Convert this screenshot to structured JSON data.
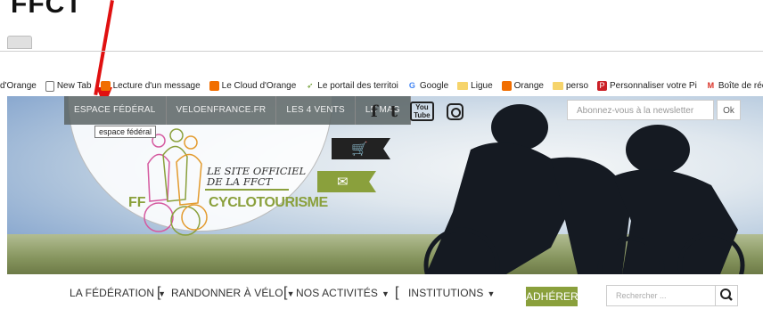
{
  "annotation": {
    "caption": "FFCT",
    "arrow_color": "#e01010"
  },
  "bookmarks": [
    {
      "label": "d'Orange",
      "icon": "none"
    },
    {
      "label": "New Tab",
      "icon": "page-icon"
    },
    {
      "label": "Lecture d'un message",
      "icon": "orange-icon"
    },
    {
      "label": "Le Cloud d'Orange",
      "icon": "orange-icon"
    },
    {
      "label": "Le portail des territoi",
      "icon": "portal-icon"
    },
    {
      "label": "Google",
      "icon": "google-icon"
    },
    {
      "label": "Ligue",
      "icon": "folder-icon"
    },
    {
      "label": "Orange",
      "icon": "orange-icon"
    },
    {
      "label": "perso",
      "icon": "folder-icon"
    },
    {
      "label": "Personnaliser votre Pi",
      "icon": "pinterest-icon"
    },
    {
      "label": "Boîte de réception",
      "icon": "gmail-icon"
    }
  ],
  "topnav": [
    "ESPACE FÉDÉRAL",
    "VELOENFRANCE.FR",
    "LES 4 VENTS",
    "LE MAG"
  ],
  "tooltip": "espace fédéral",
  "social": {
    "facebook": "f",
    "twitter": "t",
    "youtube_top": "You",
    "youtube_bottom": "Tube"
  },
  "newsletter": {
    "placeholder": "Abonnez-vous à la newsletter",
    "button": "Ok"
  },
  "logo": {
    "line1": "LE SITE OFFICIEL",
    "line2": "DE LA FFCT",
    "ff": "FF",
    "name": "CYCLOTOURISME"
  },
  "mainnav": {
    "items": [
      "LA FÉDÉRATION",
      "RANDONNER À VÉLO",
      "NOS ACTIVITÉS",
      "INSTITUTIONS"
    ],
    "adherer": "ADHÉRER",
    "search_placeholder": "Rechercher ..."
  },
  "colors": {
    "brand_green": "#8aa03c",
    "nav_gray": "#5a6464"
  }
}
